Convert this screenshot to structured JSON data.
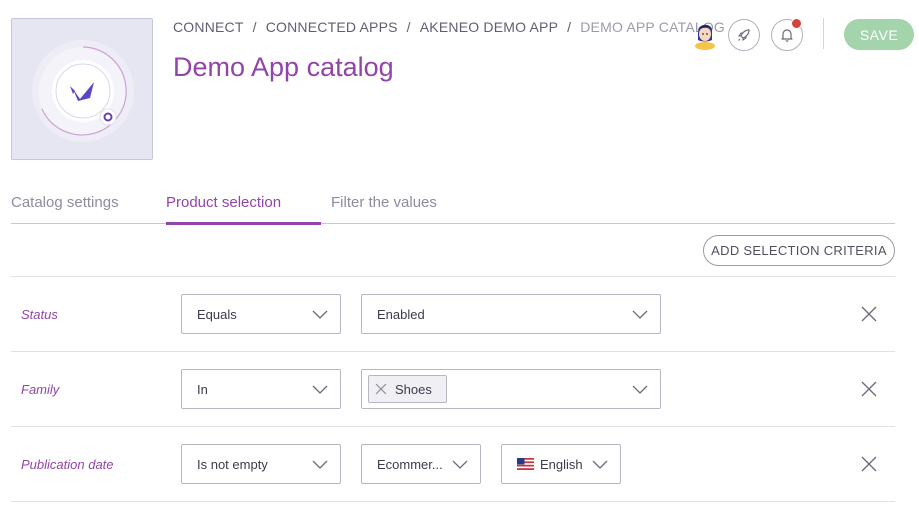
{
  "breadcrumb": {
    "items": [
      "Connect",
      "Connected apps",
      "Akeneo Demo App"
    ],
    "current": "Demo App catalog",
    "separator": "/"
  },
  "page": {
    "title": "Demo App catalog"
  },
  "header": {
    "save_label": "Save"
  },
  "tabs": [
    {
      "label": "Catalog settings",
      "active": false
    },
    {
      "label": "Product selection",
      "active": true
    },
    {
      "label": "Filter the values",
      "active": false
    }
  ],
  "criteria": {
    "add_label": "Add selection criteria",
    "rows": [
      {
        "label": "Status",
        "operator": "Equals",
        "value": "Enabled"
      },
      {
        "label": "Family",
        "operator": "In",
        "chip": "Shoes"
      },
      {
        "label": "Publication date",
        "operator": "Is not empty",
        "channel": "Ecommer...",
        "locale": "English"
      }
    ]
  },
  "colors": {
    "brand_purple": "#9244a8",
    "save_green": "#a3d4ac",
    "notification_red": "#d4433c"
  },
  "icons": [
    "akeneo-logo-icon",
    "user-avatar-icon",
    "rocket-icon",
    "bell-icon",
    "chevron-down-icon",
    "close-icon",
    "us-flag-icon"
  ]
}
